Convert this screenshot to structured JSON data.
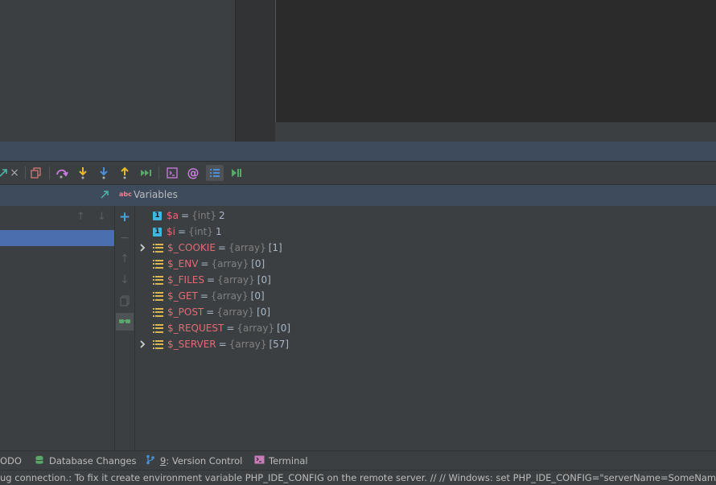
{
  "debug_toolbar": {
    "close_glyph": "×",
    "buttons": [
      "restore-layout",
      "step-over",
      "step-into",
      "force-step-into",
      "step-out",
      "run-to-cursor",
      "evaluate-expression",
      "watch-expression",
      "frames-list",
      "resume"
    ]
  },
  "frames_panel": {
    "up_glyph": "↑",
    "down_glyph": "↓"
  },
  "variables_panel": {
    "title": "Variables",
    "title_icon": "abc",
    "add_glyph": "+",
    "remove_glyph": "−",
    "up_glyph": "↑",
    "down_glyph": "↓",
    "variables": [
      {
        "name": "$a",
        "type": "{int}",
        "value": "2",
        "kind": "int",
        "expandable": false
      },
      {
        "name": "$i",
        "type": "{int}",
        "value": "1",
        "kind": "int",
        "expandable": false
      },
      {
        "name": "$_COOKIE",
        "type": "{array}",
        "value": "[1]",
        "kind": "array",
        "expandable": true
      },
      {
        "name": "$_ENV",
        "type": "{array}",
        "value": "[0]",
        "kind": "array",
        "expandable": false
      },
      {
        "name": "$_FILES",
        "type": "{array}",
        "value": "[0]",
        "kind": "array",
        "expandable": false
      },
      {
        "name": "$_GET",
        "type": "{array}",
        "value": "[0]",
        "kind": "array",
        "expandable": false
      },
      {
        "name": "$_POST",
        "type": "{array}",
        "value": "[0]",
        "kind": "array",
        "expandable": false
      },
      {
        "name": "$_REQUEST",
        "type": "{array}",
        "value": "[0]",
        "kind": "array",
        "expandable": false
      },
      {
        "name": "$_SERVER",
        "type": "{array}",
        "value": "[57]",
        "kind": "array",
        "expandable": true
      }
    ]
  },
  "tool_strip": {
    "todo": "ODO",
    "database_changes": "Database Changes",
    "version_control_num": "9",
    "version_control": ": Version Control",
    "terminal": "Terminal"
  },
  "status_bar": {
    "text": "ug connection.: To fix it create environment variable PHP_IDE_CONFIG on the remote server. // // Windows: set PHP_IDE_CONFIG=\"serverName=SomeName\" // Linux / Ma"
  },
  "colors": {
    "accent_blue": "#4b6eaf",
    "header_blue": "#3d4b5c",
    "int_icon": "#40b6e0",
    "array_icon": "#d9b64e",
    "var_name": "#e8858f"
  }
}
